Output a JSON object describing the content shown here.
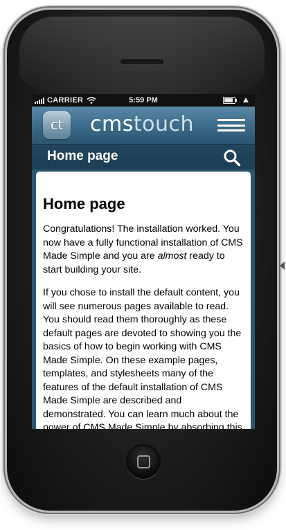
{
  "status_bar": {
    "carrier": "CARRIER",
    "time": "5:59 PM"
  },
  "header": {
    "logo_badge": "ct",
    "logo_text_part1": "cms",
    "logo_text_part2": "touch",
    "menu_icon": "hamburger-menu-icon"
  },
  "title_bar": {
    "title": "Home page",
    "search_icon": "search-icon"
  },
  "content": {
    "heading": "Home page",
    "paragraph1_part1": "Congratulations! The installation worked. You now have a fully functional installation of CMS Made Simple and you are ",
    "paragraph1_emphasis": "almost",
    "paragraph1_part2": " ready to start building your site.",
    "paragraph2": "If you chose to install the default content, you will see numerous pages available to read. You should read them thoroughly as these default pages are devoted to showing you the basics of how to begin working with CMS Made Simple. On these example pages, templates, and stylesheets many of the features of the default installation of CMS Made Simple are described and demonstrated. You can learn much about the power of CMS Made Simple by absorbing this information."
  },
  "colors": {
    "header_blue": "#3f6f8d",
    "titlebar_blue": "#1d3f55",
    "screen_bg": "#2c5570"
  }
}
